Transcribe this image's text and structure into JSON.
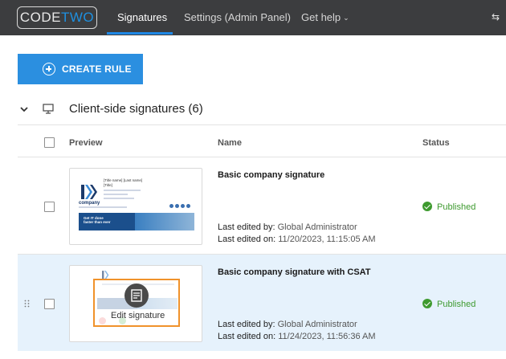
{
  "header": {
    "logo_left": "CODE",
    "logo_accent": "TWO",
    "nav": [
      {
        "label": "Signatures",
        "active": true
      },
      {
        "label": "Settings (Admin Panel)",
        "active": false
      },
      {
        "label": "Get help",
        "active": false
      }
    ]
  },
  "toolbar": {
    "create_rule_label": "CREATE RULE"
  },
  "section": {
    "title": "Client-side signatures (6)"
  },
  "table": {
    "columns": [
      "Preview",
      "Name",
      "Status"
    ],
    "rows": [
      {
        "name": "Basic company signature",
        "edited_by_label": "Last edited by:",
        "edited_by": "Global Administrator",
        "edited_on_label": "Last edited on:",
        "edited_on": "11/20/2023, 11:15:05 AM",
        "status": "Published"
      },
      {
        "name": "Basic company signature with CSAT",
        "edited_by_label": "Last edited by:",
        "edited_by": "Global Administrator",
        "edited_on_label": "Last edited on:",
        "edited_on": "11/24/2023, 11:56:36 AM",
        "status": "Published",
        "hover_action": "Edit signature"
      }
    ]
  },
  "preview_sample": {
    "name_line": "[Title name] [Last name]",
    "title_line": "[Title]",
    "company": "company",
    "banner_line1": "Get IT done",
    "banner_line2": "faster than ever",
    "banner_button": "LEARN MORE"
  },
  "colors": {
    "topbar": "#3c3d3f",
    "accent": "#1e88e5",
    "published": "#3e9a2f",
    "highlight_row": "#e6f2fc",
    "edit_border": "#f0922b"
  }
}
